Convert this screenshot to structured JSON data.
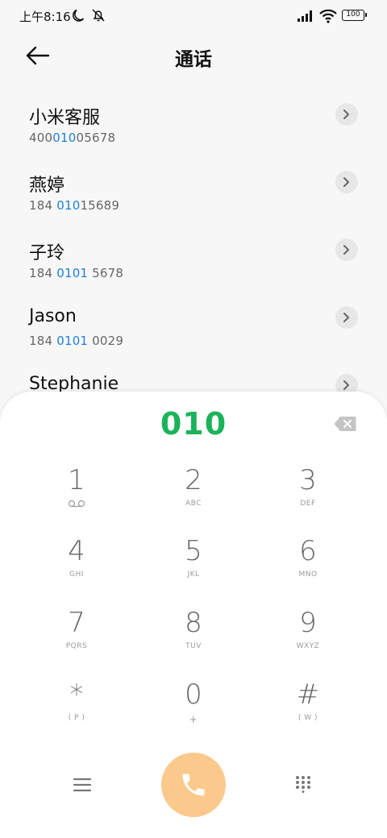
{
  "status_bar": {
    "time": "上午8:16",
    "battery": "100"
  },
  "header": {
    "title": "通话"
  },
  "contacts": [
    {
      "name": "小米客服",
      "number_pre": "400",
      "number_hl": "010",
      "number_post": "05678"
    },
    {
      "name": "燕婷",
      "number_pre": "184 ",
      "number_hl": "010",
      "number_post": "15689"
    },
    {
      "name": "子玲",
      "number_pre": "184 ",
      "number_hl": "0101",
      "number_post": " 5678"
    },
    {
      "name": "Jason",
      "number_pre": "184 ",
      "number_hl": "0101",
      "number_post": " 0029"
    },
    {
      "name": "Stephanie",
      "number_pre": "",
      "number_hl": "",
      "number_post": ""
    }
  ],
  "dialer": {
    "dialed": "010",
    "keys": [
      {
        "digit": "1",
        "letters": ""
      },
      {
        "digit": "2",
        "letters": "ABC"
      },
      {
        "digit": "3",
        "letters": "DEF"
      },
      {
        "digit": "4",
        "letters": "GHI"
      },
      {
        "digit": "5",
        "letters": "JKL"
      },
      {
        "digit": "6",
        "letters": "MNO"
      },
      {
        "digit": "7",
        "letters": "PQRS"
      },
      {
        "digit": "8",
        "letters": "TUV"
      },
      {
        "digit": "9",
        "letters": "WXYZ"
      },
      {
        "digit": "*",
        "letters": "( P )"
      },
      {
        "digit": "0",
        "letters": "+"
      },
      {
        "digit": "#",
        "letters": "( W )"
      }
    ]
  },
  "colors": {
    "accent_green": "#1bb35a",
    "highlight_blue": "#1e7fd6",
    "call_button": "#fbc98b"
  }
}
